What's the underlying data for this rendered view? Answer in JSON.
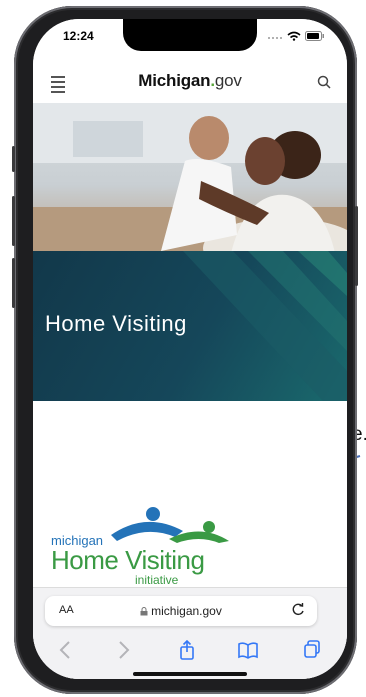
{
  "status_bar": {
    "time": "12:24"
  },
  "header": {
    "brand_main": "Michigan",
    "brand_dot": ".",
    "brand_suffix": "gov"
  },
  "banner": {
    "title": "Home Visiting"
  },
  "logo": {
    "line_small": "michigan",
    "line_big": "Home Visiting",
    "line_sub": "initiative"
  },
  "stray_text": "e.",
  "safari": {
    "text_size_label": "AA",
    "url": "michigan.gov"
  },
  "colors": {
    "banner": "#15475a",
    "logo_blue": "#2473b8",
    "logo_green": "#3a9a44",
    "safari_accent": "#3478f6"
  },
  "icons": [
    "menu-icon",
    "search-icon",
    "signal-icon",
    "wifi-icon",
    "battery-icon",
    "lock-icon",
    "reload-icon",
    "back-icon",
    "forward-icon",
    "share-icon",
    "bookmarks-icon",
    "tabs-icon"
  ]
}
